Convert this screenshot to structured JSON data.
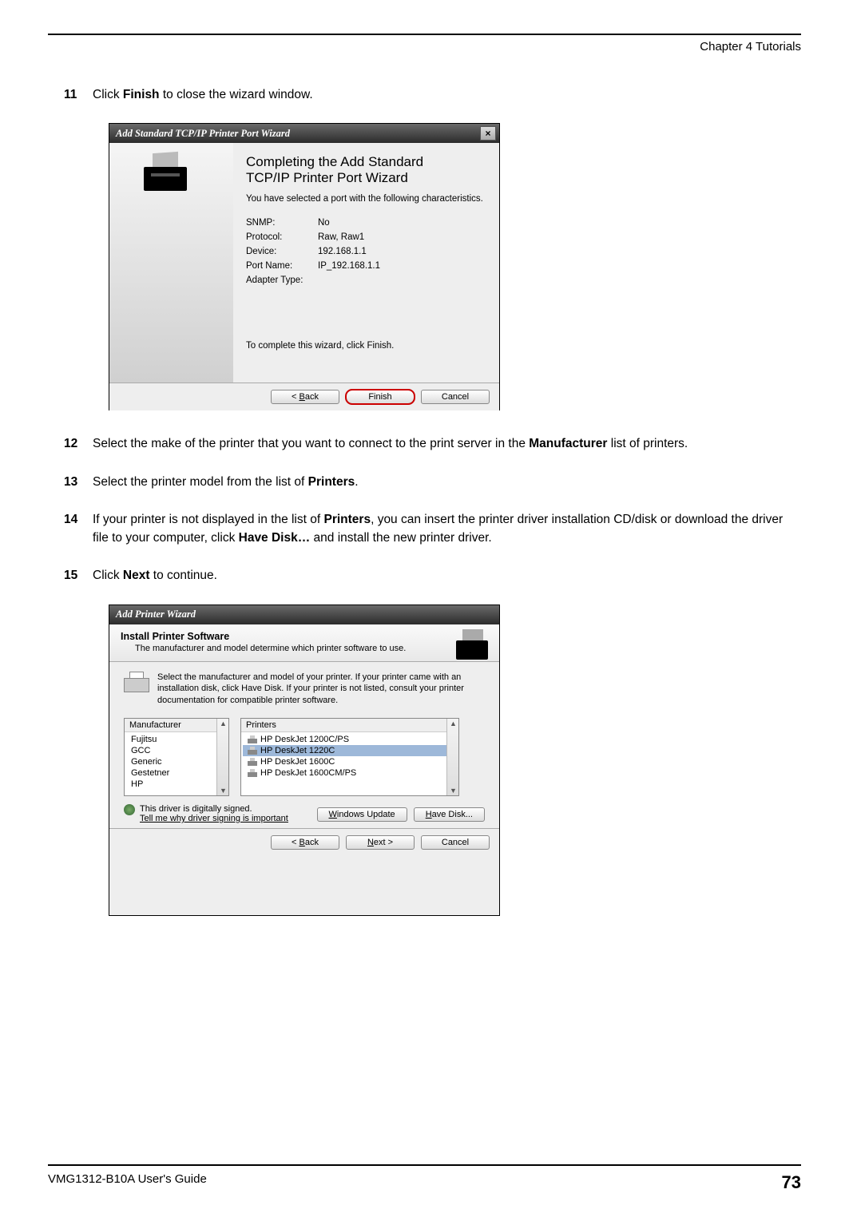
{
  "header": {
    "chapter": "Chapter 4 Tutorials"
  },
  "steps": {
    "s11": {
      "num": "11",
      "pre": "Click ",
      "bold": "Finish",
      "post": " to close the wizard window."
    },
    "s12": {
      "num": "12",
      "pre": "Select the make of the printer that you want to connect to the print server in the ",
      "bold": "Manufacturer",
      "post": " list of printers."
    },
    "s13": {
      "num": "13",
      "pre": "Select the printer model from the list of ",
      "bold": "Printers",
      "post": "."
    },
    "s14": {
      "num": "14",
      "pre": "If your printer is not displayed in the list of ",
      "bold1": "Printers",
      "mid": ", you can insert the printer driver installation CD/disk or download the driver file to your computer, click ",
      "bold2": "Have Disk…",
      "post": " and install the new printer driver."
    },
    "s15": {
      "num": "15",
      "pre": "Click ",
      "bold": "Next",
      "post": " to continue."
    }
  },
  "dlg1": {
    "title": "Add Standard TCP/IP Printer Port Wizard",
    "heading_l1": "Completing the Add Standard",
    "heading_l2": "TCP/IP Printer Port Wizard",
    "sub": "You have selected a port with the following characteristics.",
    "rows": {
      "snmp_k": "SNMP:",
      "snmp_v": "No",
      "proto_k": "Protocol:",
      "proto_v": "Raw, Raw1",
      "dev_k": "Device:",
      "dev_v": "192.168.1.1",
      "port_k": "Port Name:",
      "port_v": "IP_192.168.1.1",
      "adapt_k": "Adapter Type:",
      "adapt_v": ""
    },
    "complete": "To complete this wizard, click Finish.",
    "buttons": {
      "back_pre": "< ",
      "back_u": "B",
      "back_post": "ack",
      "finish": "Finish",
      "cancel": "Cancel"
    }
  },
  "dlg2": {
    "title": "Add Printer Wizard",
    "head_t": "Install Printer Software",
    "head_s": "The manufacturer and model determine which printer software to use.",
    "instr": "Select the manufacturer and model of your printer. If your printer came with an installation disk, click Have Disk. If your printer is not listed, consult your printer documentation for compatible printer software.",
    "manu_head": "Manufacturer",
    "manu": {
      "m0": "Fujitsu",
      "m1": "GCC",
      "m2": "Generic",
      "m3": "Gestetner",
      "m4": "HP"
    },
    "prn_head": "Printers",
    "prn": {
      "p0": "HP DeskJet 1200C/PS",
      "p1": "HP DeskJet 1220C",
      "p2": "HP DeskJet 1600C",
      "p3": "HP DeskJet 1600CM/PS"
    },
    "signed": "This driver is digitally signed.",
    "tell_u": "T",
    "tell_rest": "ell me why driver signing is important",
    "wu_u": "W",
    "wu_rest": "indows Update",
    "hd_u": "H",
    "hd_rest": "ave Disk...",
    "buttons": {
      "back_pre": "< ",
      "back_u": "B",
      "back_post": "ack",
      "next_u": "N",
      "next_rest": "ext >",
      "cancel": "Cancel"
    }
  },
  "footer": {
    "guide": "VMG1312-B10A User's Guide",
    "page": "73"
  }
}
